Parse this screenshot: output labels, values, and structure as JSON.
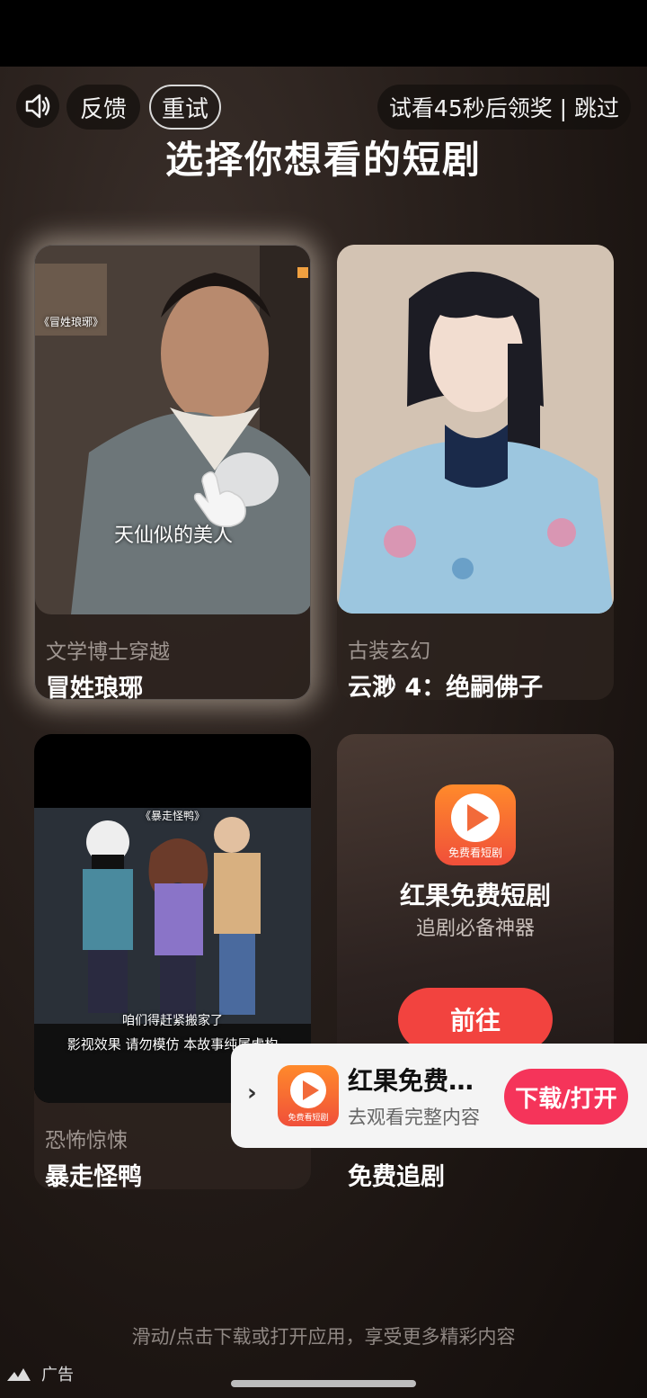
{
  "topbar": {
    "sound_icon": "speaker-icon",
    "feedback_label": "反馈",
    "retry_label": "重试",
    "skip_label": "试看45秒后领奖 | 跳过"
  },
  "title": "选择你想看的短剧",
  "cards": [
    {
      "genre": "文学博士穿越",
      "name": "冒姓琅琊",
      "overlay_top": "《冒姓琅琊》",
      "overlay_subtitle": "天仙似的美人"
    },
    {
      "genre": "古装玄幻",
      "name": "云渺 4：绝嗣佛子"
    },
    {
      "genre": "恐怖惊悚",
      "name": "暴走怪鸭",
      "overlay_top": "《暴走怪鸭》",
      "overlay_line1": "咱们得赶紧搬家了",
      "overlay_line2": "影视效果 请勿模仿 本故事纯属虚构"
    },
    {
      "name": "免费追剧",
      "app_name": "红果免费短剧",
      "app_sub": "追剧必备神器",
      "goto_label": "前往",
      "logo_caption": "免费看短剧"
    }
  ],
  "banner": {
    "chevron": "›",
    "title": "红果免费…",
    "sub": "去观看完整内容",
    "button": "下载/打开",
    "logo_caption": "免费看短剧"
  },
  "footer": {
    "hint": "滑动/点击下载或打开应用，享受更多精彩内容",
    "ad_label": "广告"
  },
  "colors": {
    "accent_red": "#f2433f",
    "download_pink": "#f5345a"
  }
}
